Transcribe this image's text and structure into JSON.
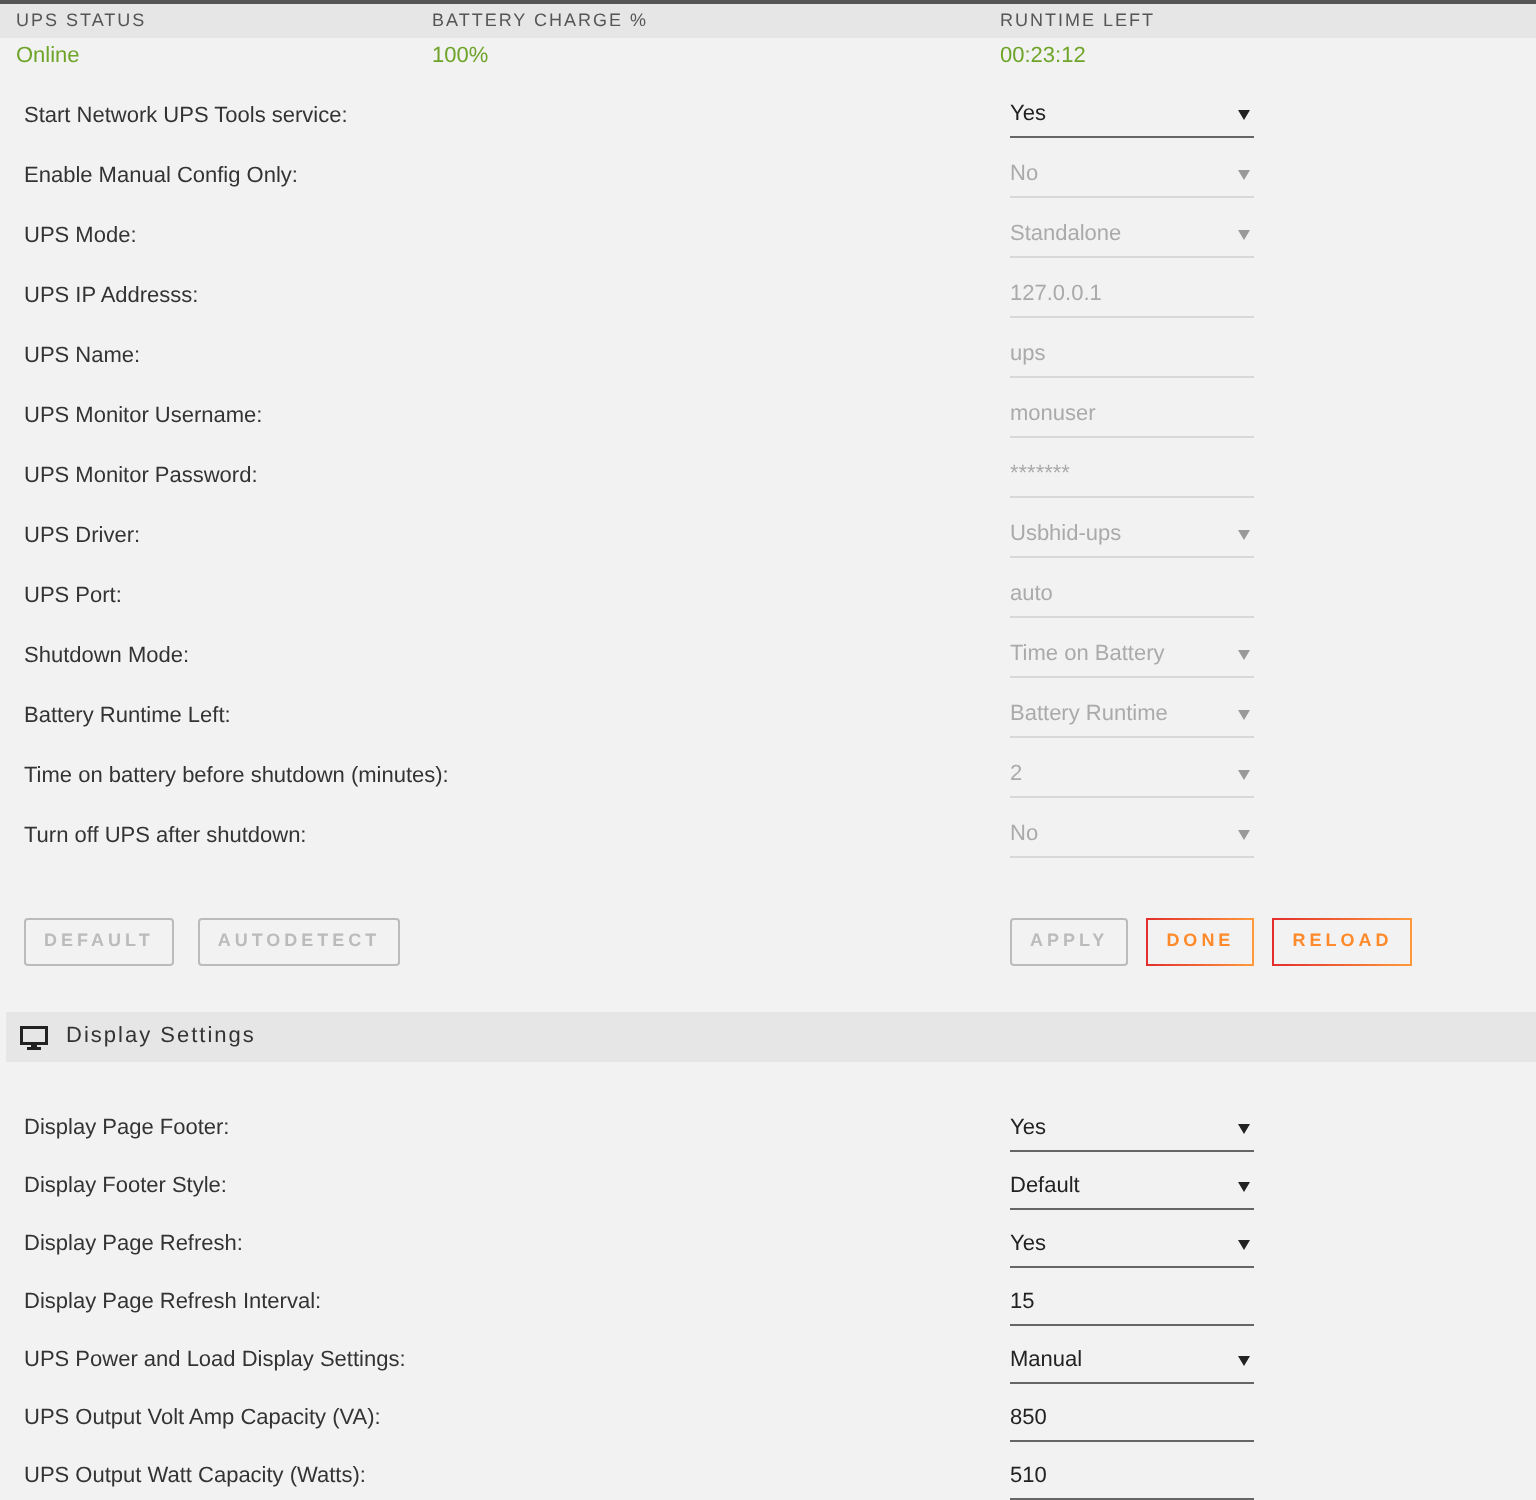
{
  "status_table": {
    "columns": [
      "UPS STATUS",
      "BATTERY CHARGE %",
      "RUNTIME LEFT"
    ],
    "rows": [
      [
        "Online",
        "100%",
        "00:23:12"
      ]
    ]
  },
  "ups_settings": [
    {
      "label": "Start Network UPS Tools service:",
      "kind": "select",
      "value": "Yes",
      "disabled": false
    },
    {
      "label": "Enable Manual Config Only:",
      "kind": "select",
      "value": "No",
      "disabled": true
    },
    {
      "label": "UPS Mode:",
      "kind": "select",
      "value": "Standalone",
      "disabled": true
    },
    {
      "label": "UPS IP Addresss:",
      "kind": "input",
      "value": "127.0.0.1",
      "disabled": true
    },
    {
      "label": "UPS Name:",
      "kind": "input",
      "value": "ups",
      "disabled": true
    },
    {
      "label": "UPS Monitor Username:",
      "kind": "input",
      "value": "monuser",
      "disabled": true
    },
    {
      "label": "UPS Monitor Password:",
      "kind": "input",
      "value": "*******",
      "disabled": true
    },
    {
      "label": "UPS Driver:",
      "kind": "select",
      "value": "Usbhid-ups",
      "disabled": true
    },
    {
      "label": "UPS Port:",
      "kind": "input",
      "value": "auto",
      "disabled": true
    },
    {
      "label": "Shutdown Mode:",
      "kind": "select",
      "value": "Time on Battery",
      "disabled": true
    },
    {
      "label": "Battery Runtime Left:",
      "kind": "select",
      "value": "Battery Runtime",
      "disabled": true
    },
    {
      "label": "Time on battery before shutdown (minutes):",
      "kind": "select",
      "value": "2",
      "disabled": true
    },
    {
      "label": "Turn off UPS after shutdown:",
      "kind": "select",
      "value": "No",
      "disabled": true
    }
  ],
  "left_buttons": [
    {
      "label": "DEFAULT",
      "disabled": true
    },
    {
      "label": "AUTODETECT",
      "disabled": true
    }
  ],
  "right_buttons": [
    {
      "label": "APPLY",
      "disabled": true
    },
    {
      "label": "DONE",
      "disabled": false
    },
    {
      "label": "RELOAD",
      "disabled": false
    }
  ],
  "display_section": {
    "title": "Display Settings",
    "settings": [
      {
        "label": "Display Page Footer:",
        "kind": "select",
        "value": "Yes",
        "disabled": false
      },
      {
        "label": "Display Footer Style:",
        "kind": "select",
        "value": "Default",
        "disabled": false
      },
      {
        "label": "Display Page Refresh:",
        "kind": "select",
        "value": "Yes",
        "disabled": false
      },
      {
        "label": "Display Page Refresh Interval:",
        "kind": "input",
        "value": "15",
        "disabled": false
      },
      {
        "label": "UPS Power and Load Display Settings:",
        "kind": "select",
        "value": "Manual",
        "disabled": false
      },
      {
        "label": "UPS Output Volt Amp Capacity (VA):",
        "kind": "input",
        "value": "850",
        "disabled": false
      },
      {
        "label": "UPS Output Watt Capacity (Watts):",
        "kind": "input",
        "value": "510",
        "disabled": false
      }
    ]
  }
}
